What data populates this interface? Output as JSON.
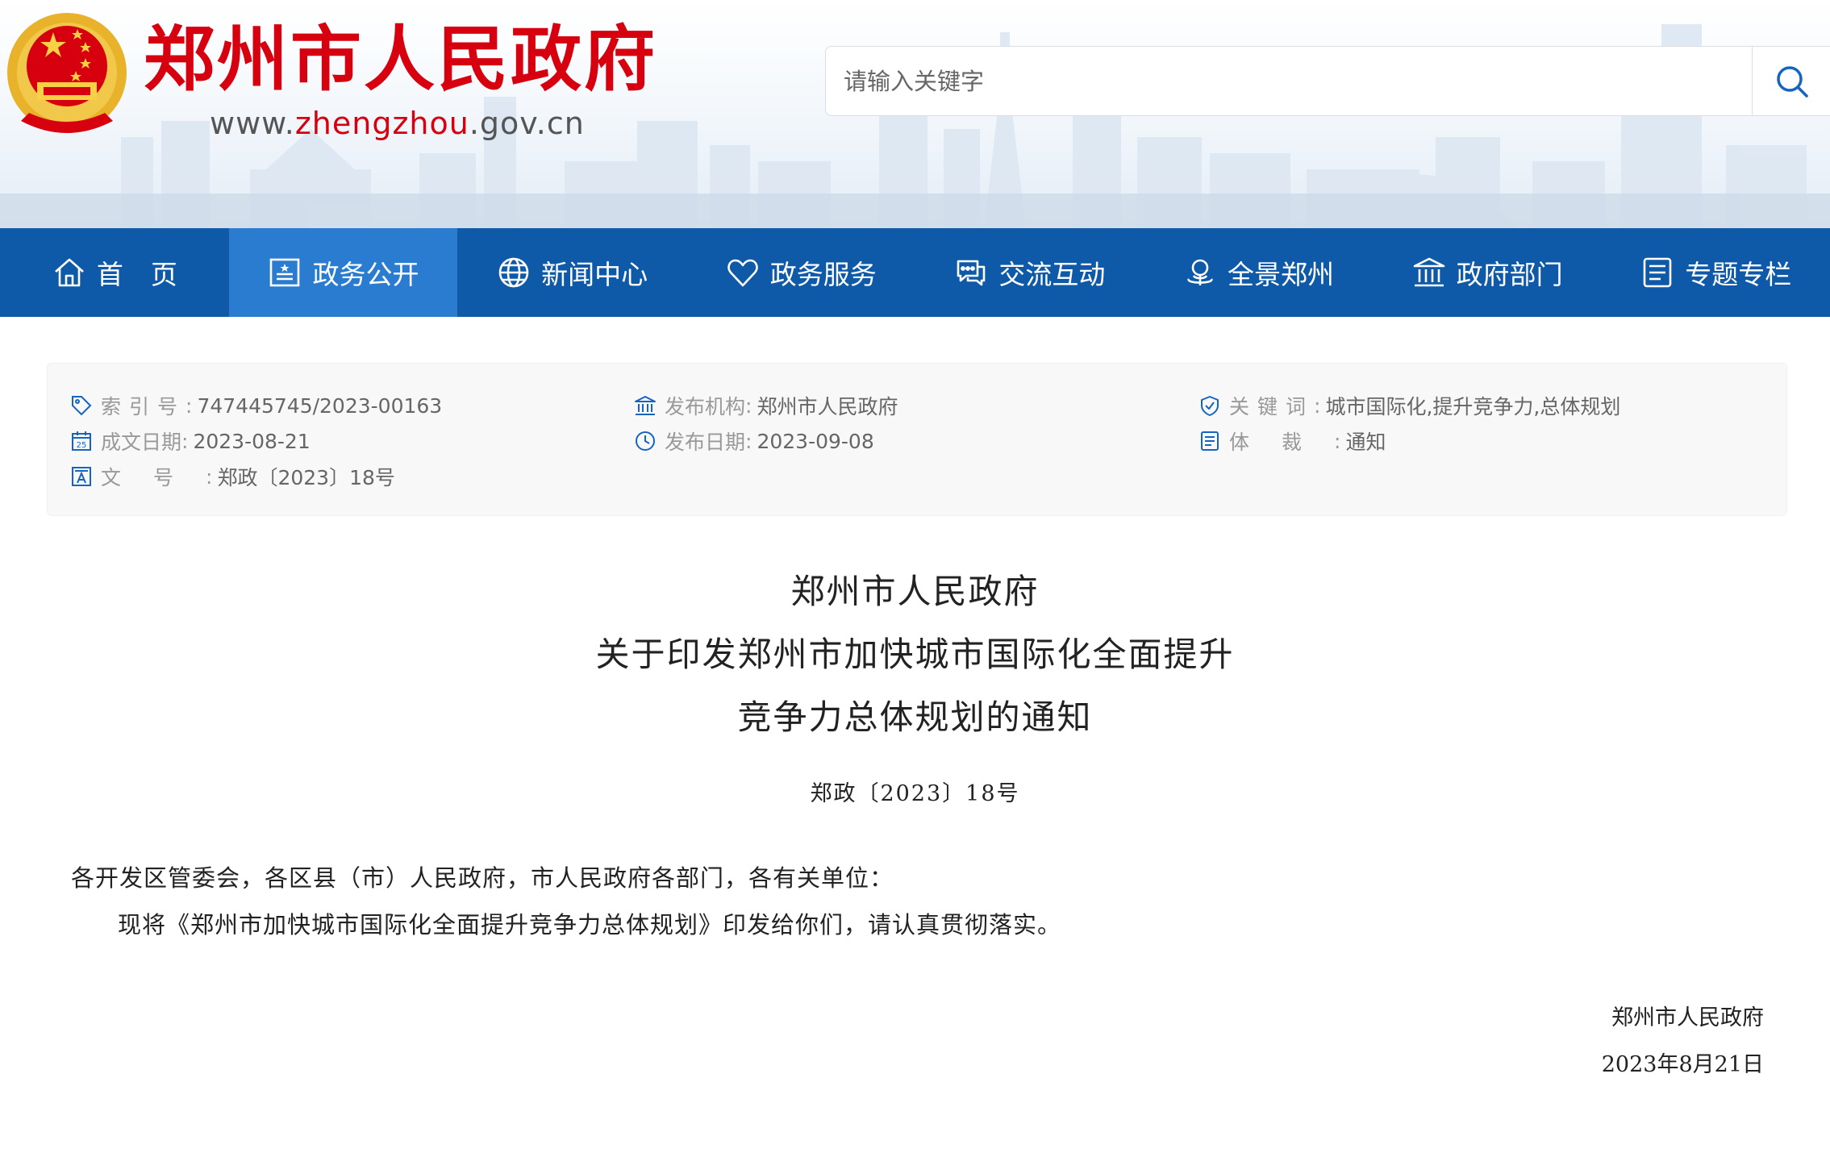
{
  "header": {
    "site_title": "郑州市人民政府",
    "url_prefix": "www.",
    "url_highlight": "zhengzhou",
    "url_suffix": ".gov.cn",
    "search_placeholder": "请输入关键字"
  },
  "nav": {
    "items": [
      {
        "label": "首页",
        "icon": "home-icon"
      },
      {
        "label": "政务公开",
        "icon": "bulletin-icon"
      },
      {
        "label": "新闻中心",
        "icon": "globe-icon"
      },
      {
        "label": "政务服务",
        "icon": "heart-icon"
      },
      {
        "label": "交流互动",
        "icon": "chat-icon"
      },
      {
        "label": "全景郑州",
        "icon": "panorama-icon"
      },
      {
        "label": "政府部门",
        "icon": "building-icon"
      },
      {
        "label": "专题专栏",
        "icon": "list-icon"
      }
    ]
  },
  "meta": {
    "index_label": "索引号",
    "index_value": "747445745/2023-00163",
    "publisher_label": "发布机构",
    "publisher_value": "郑州市人民政府",
    "keywords_label": "关键词",
    "keywords_value": "城市国际化,提升竞争力,总体规划",
    "created_label": "成文日期",
    "created_value": "2023-08-21",
    "published_label": "发布日期",
    "published_value": "2023-09-08",
    "genre_label": "体裁",
    "genre_value": "通知",
    "docno_label": "文号",
    "docno_value": "郑政〔2023〕18号",
    "colon": ":"
  },
  "document": {
    "title_line1": "郑州市人民政府",
    "title_line2": "关于印发郑州市加快城市国际化全面提升",
    "title_line3": "竞争力总体规划的通知",
    "number": "郑政〔2023〕18号",
    "recipients": "各开发区管委会，各区县（市）人民政府，市人民政府各部门，各有关单位：",
    "body": "现将《郑州市加快城市国际化全面提升竞争力总体规划》印发给你们，请认真贯彻落实。",
    "signature": "郑州市人民政府",
    "date": "2023年8月21日"
  },
  "colors": {
    "brand_red": "#d7000f",
    "nav_blue": "#0e5aa8",
    "nav_active": "#2a7cd0"
  }
}
